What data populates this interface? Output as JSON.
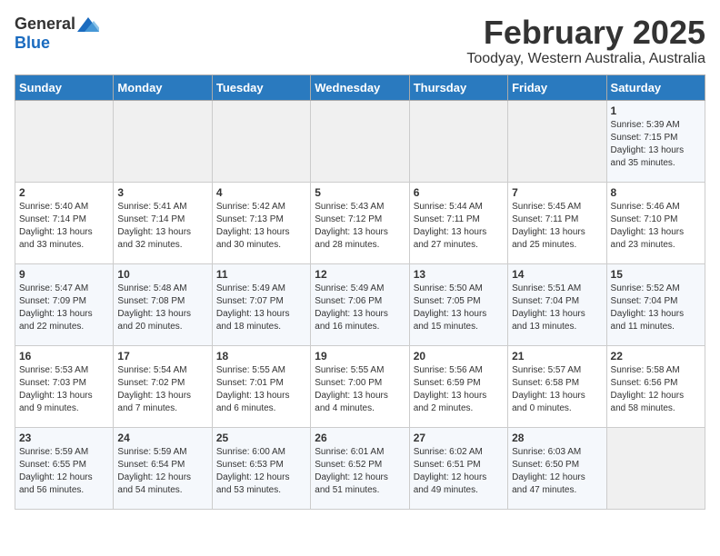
{
  "header": {
    "logo_general": "General",
    "logo_blue": "Blue",
    "month_title": "February 2025",
    "location": "Toodyay, Western Australia, Australia"
  },
  "days_of_week": [
    "Sunday",
    "Monday",
    "Tuesday",
    "Wednesday",
    "Thursday",
    "Friday",
    "Saturday"
  ],
  "weeks": [
    [
      {
        "day": "",
        "info": ""
      },
      {
        "day": "",
        "info": ""
      },
      {
        "day": "",
        "info": ""
      },
      {
        "day": "",
        "info": ""
      },
      {
        "day": "",
        "info": ""
      },
      {
        "day": "",
        "info": ""
      },
      {
        "day": "1",
        "info": "Sunrise: 5:39 AM\nSunset: 7:15 PM\nDaylight: 13 hours\nand 35 minutes."
      }
    ],
    [
      {
        "day": "2",
        "info": "Sunrise: 5:40 AM\nSunset: 7:14 PM\nDaylight: 13 hours\nand 33 minutes."
      },
      {
        "day": "3",
        "info": "Sunrise: 5:41 AM\nSunset: 7:14 PM\nDaylight: 13 hours\nand 32 minutes."
      },
      {
        "day": "4",
        "info": "Sunrise: 5:42 AM\nSunset: 7:13 PM\nDaylight: 13 hours\nand 30 minutes."
      },
      {
        "day": "5",
        "info": "Sunrise: 5:43 AM\nSunset: 7:12 PM\nDaylight: 13 hours\nand 28 minutes."
      },
      {
        "day": "6",
        "info": "Sunrise: 5:44 AM\nSunset: 7:11 PM\nDaylight: 13 hours\nand 27 minutes."
      },
      {
        "day": "7",
        "info": "Sunrise: 5:45 AM\nSunset: 7:11 PM\nDaylight: 13 hours\nand 25 minutes."
      },
      {
        "day": "8",
        "info": "Sunrise: 5:46 AM\nSunset: 7:10 PM\nDaylight: 13 hours\nand 23 minutes."
      }
    ],
    [
      {
        "day": "9",
        "info": "Sunrise: 5:47 AM\nSunset: 7:09 PM\nDaylight: 13 hours\nand 22 minutes."
      },
      {
        "day": "10",
        "info": "Sunrise: 5:48 AM\nSunset: 7:08 PM\nDaylight: 13 hours\nand 20 minutes."
      },
      {
        "day": "11",
        "info": "Sunrise: 5:49 AM\nSunset: 7:07 PM\nDaylight: 13 hours\nand 18 minutes."
      },
      {
        "day": "12",
        "info": "Sunrise: 5:49 AM\nSunset: 7:06 PM\nDaylight: 13 hours\nand 16 minutes."
      },
      {
        "day": "13",
        "info": "Sunrise: 5:50 AM\nSunset: 7:05 PM\nDaylight: 13 hours\nand 15 minutes."
      },
      {
        "day": "14",
        "info": "Sunrise: 5:51 AM\nSunset: 7:04 PM\nDaylight: 13 hours\nand 13 minutes."
      },
      {
        "day": "15",
        "info": "Sunrise: 5:52 AM\nSunset: 7:04 PM\nDaylight: 13 hours\nand 11 minutes."
      }
    ],
    [
      {
        "day": "16",
        "info": "Sunrise: 5:53 AM\nSunset: 7:03 PM\nDaylight: 13 hours\nand 9 minutes."
      },
      {
        "day": "17",
        "info": "Sunrise: 5:54 AM\nSunset: 7:02 PM\nDaylight: 13 hours\nand 7 minutes."
      },
      {
        "day": "18",
        "info": "Sunrise: 5:55 AM\nSunset: 7:01 PM\nDaylight: 13 hours\nand 6 minutes."
      },
      {
        "day": "19",
        "info": "Sunrise: 5:55 AM\nSunset: 7:00 PM\nDaylight: 13 hours\nand 4 minutes."
      },
      {
        "day": "20",
        "info": "Sunrise: 5:56 AM\nSunset: 6:59 PM\nDaylight: 13 hours\nand 2 minutes."
      },
      {
        "day": "21",
        "info": "Sunrise: 5:57 AM\nSunset: 6:58 PM\nDaylight: 13 hours\nand 0 minutes."
      },
      {
        "day": "22",
        "info": "Sunrise: 5:58 AM\nSunset: 6:56 PM\nDaylight: 12 hours\nand 58 minutes."
      }
    ],
    [
      {
        "day": "23",
        "info": "Sunrise: 5:59 AM\nSunset: 6:55 PM\nDaylight: 12 hours\nand 56 minutes."
      },
      {
        "day": "24",
        "info": "Sunrise: 5:59 AM\nSunset: 6:54 PM\nDaylight: 12 hours\nand 54 minutes."
      },
      {
        "day": "25",
        "info": "Sunrise: 6:00 AM\nSunset: 6:53 PM\nDaylight: 12 hours\nand 53 minutes."
      },
      {
        "day": "26",
        "info": "Sunrise: 6:01 AM\nSunset: 6:52 PM\nDaylight: 12 hours\nand 51 minutes."
      },
      {
        "day": "27",
        "info": "Sunrise: 6:02 AM\nSunset: 6:51 PM\nDaylight: 12 hours\nand 49 minutes."
      },
      {
        "day": "28",
        "info": "Sunrise: 6:03 AM\nSunset: 6:50 PM\nDaylight: 12 hours\nand 47 minutes."
      },
      {
        "day": "",
        "info": ""
      }
    ]
  ]
}
